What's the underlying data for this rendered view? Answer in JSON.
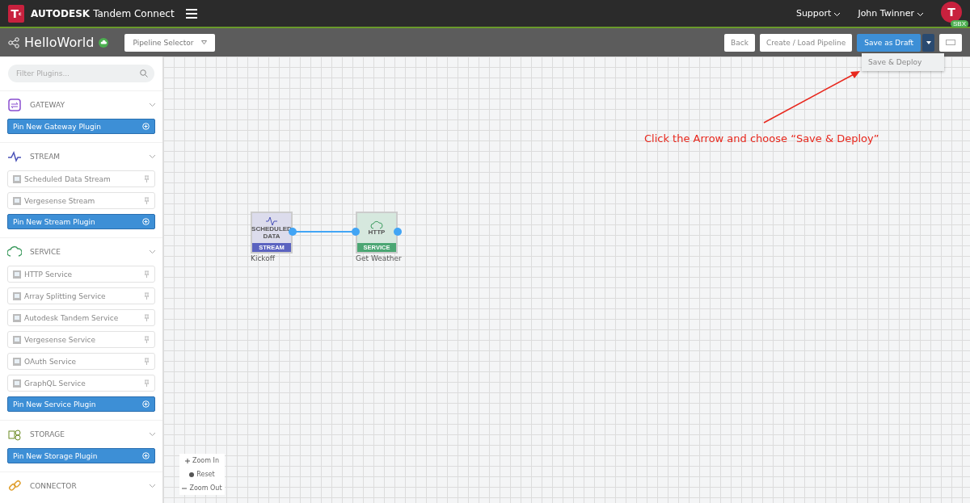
{
  "app": {
    "brand": "AUTODESK",
    "product": "Tandem Connect",
    "logo_letter": "T",
    "logo_sub": "c"
  },
  "top_nav": {
    "links": [
      "Support",
      "John Twinner"
    ],
    "avatar_letter": "T",
    "avatar_badge": "SBX"
  },
  "pipeline_bar": {
    "name": "HelloWorld",
    "selector": "Pipeline Selector",
    "buttons": [
      "Back",
      "Create / Load Pipeline"
    ],
    "primary": "Save as Draft",
    "menu": {
      "expanded": true,
      "items": [
        "Save & Deploy"
      ]
    }
  },
  "sidebar": {
    "filter_placeholder": "Filter Plugins...",
    "sections": [
      {
        "kind": "gateway",
        "title": "GATEWAY",
        "pin_button": "Pin New Gateway Plugin"
      },
      {
        "kind": "stream",
        "title": "STREAM",
        "items": [
          "Scheduled Data Stream",
          "Vergesense Stream"
        ],
        "pin_button": "Pin New Stream Plugin"
      },
      {
        "kind": "service",
        "title": "SERVICE",
        "items": [
          "HTTP Service",
          "Array Splitting Service",
          "Autodesk Tandem Service",
          "Vergesense Service",
          "OAuth Service",
          "GraphQL Service"
        ],
        "pin_button": "Pin New Service Plugin"
      },
      {
        "kind": "storage",
        "title": "STORAGE",
        "pin_button": "Pin New Storage Plugin"
      },
      {
        "kind": "connector",
        "title": "CONNECTOR"
      }
    ]
  },
  "canvas": {
    "nodes": [
      {
        "kind": "stream",
        "title": "SCHEDULED DATA",
        "type_label": "STREAM",
        "name": "Kickoff"
      },
      {
        "kind": "service",
        "title": "HTTP",
        "type_label": "SERVICE",
        "name": "Get Weather"
      }
    ],
    "zoom_controls": [
      "Zoom In",
      "Reset",
      "Zoom Out"
    ],
    "annotation": "Click the Arrow and choose “Save & Deploy”"
  }
}
